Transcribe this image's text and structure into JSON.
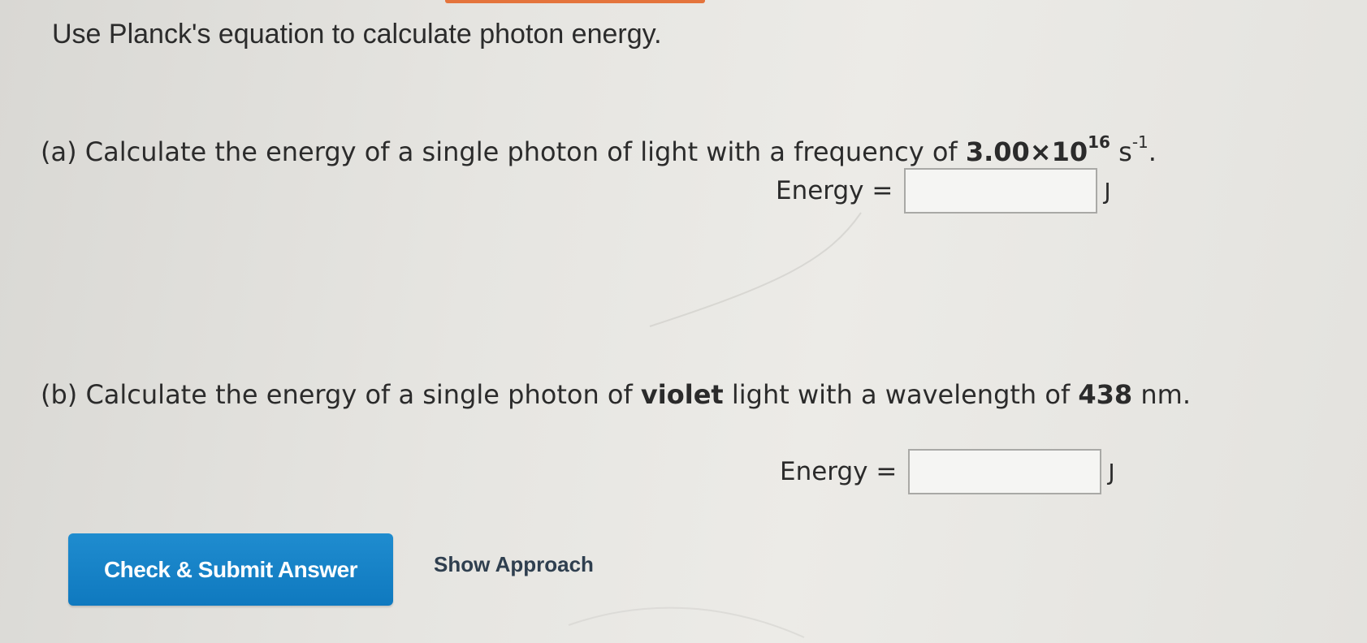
{
  "title": "Use Planck's equation to calculate photon energy.",
  "part_a": {
    "prefix": "(a) Calculate the energy of a single photon of light with a frequency of ",
    "value": "3.00×10",
    "exponent": "16",
    "unit_base": " s",
    "unit_exp": "-1",
    "suffix": ".",
    "answer_label": "Energy =",
    "answer_value": "",
    "answer_unit": "J"
  },
  "part_b": {
    "prefix": "(b) Calculate the energy of a single photon of ",
    "bold_word": "violet",
    "middle": " light with a wavelength of ",
    "value": "438",
    "unit": " nm.",
    "answer_label": "Energy =",
    "answer_value": "",
    "answer_unit": "J"
  },
  "buttons": {
    "submit_label": "Check & Submit Answer",
    "approach_label": "Show Approach"
  },
  "colors": {
    "submit_bg": "#1583c8",
    "accent_top": "#e4743c",
    "text": "#2b2b2b"
  }
}
